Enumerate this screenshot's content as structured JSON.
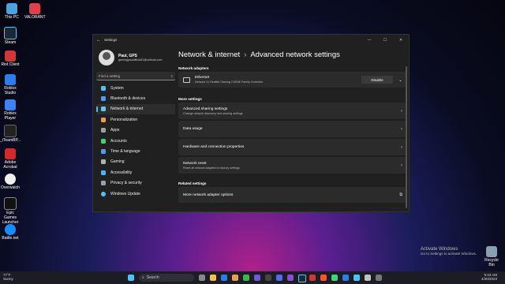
{
  "desktop": {
    "icons": [
      {
        "label": "This PC",
        "color": "#4aa3df"
      },
      {
        "label": "VALORANT",
        "color": "#e0404a"
      },
      {
        "label": "Steam",
        "color": "#1b2838"
      },
      {
        "label": "Riot Client",
        "color": "#d13639"
      },
      {
        "label": "Roblox Studio",
        "color": "#2b7de9"
      },
      {
        "label": "Roblox Player",
        "color": "#3b82f6"
      },
      {
        "label": "_iTeamBP...",
        "color": "#222222"
      },
      {
        "label": "Adobe Acrobat",
        "color": "#d4282a"
      },
      {
        "label": "Overwatch",
        "color": "#f0f0f0"
      },
      {
        "label": "Epic Games Launcher",
        "color": "#111111"
      },
      {
        "label": "Battle.net",
        "color": "#148eff"
      }
    ],
    "recycle_bin": "Recycle Bin",
    "activate_title": "Activate Windows",
    "activate_sub": "Go to Settings to activate Windows."
  },
  "window": {
    "title": "Settings",
    "back_icon": "back-arrow-icon",
    "controls": {
      "minimize": "—",
      "maximize": "☐",
      "close": "✕"
    }
  },
  "profile": {
    "name": "Paul, GPS",
    "email": "gamingpaulofficial11@outlook.com"
  },
  "search": {
    "placeholder": "Find a setting",
    "icon": "search-icon"
  },
  "nav": {
    "items": [
      {
        "label": "System",
        "icon": "system-icon",
        "color": "#4cc2ff"
      },
      {
        "label": "Bluetooth & devices",
        "icon": "bluetooth-icon",
        "color": "#4c9bff"
      },
      {
        "label": "Network & internet",
        "icon": "wifi-icon",
        "color": "#5ec8f0",
        "active": true
      },
      {
        "label": "Personalization",
        "icon": "brush-icon",
        "color": "#e8a04c"
      },
      {
        "label": "Apps",
        "icon": "apps-icon",
        "color": "#9aa0a6"
      },
      {
        "label": "Accounts",
        "icon": "person-icon",
        "color": "#3fd47a"
      },
      {
        "label": "Time & language",
        "icon": "globe-icon",
        "color": "#4c9bff"
      },
      {
        "label": "Gaming",
        "icon": "gamepad-icon",
        "color": "#b0b0b0"
      },
      {
        "label": "Accessibility",
        "icon": "accessibility-icon",
        "color": "#4cb4ff"
      },
      {
        "label": "Privacy & security",
        "icon": "shield-icon",
        "color": "#9aa0a6"
      },
      {
        "label": "Windows Update",
        "icon": "update-icon",
        "color": "#4cc2ff"
      }
    ]
  },
  "breadcrumb": {
    "parent": "Network & internet",
    "separator": "›",
    "current": "Advanced network settings"
  },
  "network_adapters": {
    "heading": "Network adapters",
    "adapter": {
      "name": "Ethernet",
      "description": "Network 4 | Realtek Gaming 2.5GbE Family Controller",
      "button": "Disable"
    }
  },
  "more_settings": {
    "heading": "More settings",
    "items": [
      {
        "title": "Advanced sharing settings",
        "subtitle": "Change network discovery and sharing settings"
      },
      {
        "title": "Data usage",
        "subtitle": ""
      },
      {
        "title": "Hardware and connection properties",
        "subtitle": ""
      },
      {
        "title": "Network reset",
        "subtitle": "Reset all network adapters to factory settings"
      }
    ]
  },
  "related_settings": {
    "heading": "Related settings",
    "items": [
      {
        "title": "More network adapter options",
        "icon": "external-link-icon"
      }
    ]
  },
  "taskbar": {
    "weather_temp": "77°F",
    "weather_desc": "Sunny",
    "search_label": "Search",
    "time": "9:43 AM",
    "date": "4/30/2023"
  }
}
